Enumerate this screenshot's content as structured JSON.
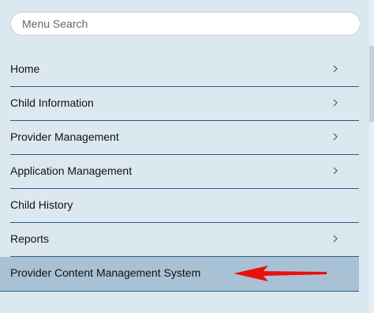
{
  "search": {
    "placeholder": "Menu Search"
  },
  "menu": {
    "items": [
      {
        "label": "Home",
        "has_submenu": true
      },
      {
        "label": "Child Information",
        "has_submenu": true
      },
      {
        "label": "Provider Management",
        "has_submenu": true
      },
      {
        "label": "Application Management",
        "has_submenu": true
      },
      {
        "label": "Child History",
        "has_submenu": false
      },
      {
        "label": "Reports",
        "has_submenu": true
      },
      {
        "label": "Provider Content Management System",
        "has_submenu": false,
        "active": true
      }
    ]
  },
  "colors": {
    "panel_background": "#dce8f0",
    "active_item_background": "#a9c1d5",
    "divider": "#2e5a86",
    "annotation_arrow": "#e8100c"
  },
  "icons": {
    "submenu": "chevron-right-icon",
    "annotation": "red-arrow-icon"
  }
}
